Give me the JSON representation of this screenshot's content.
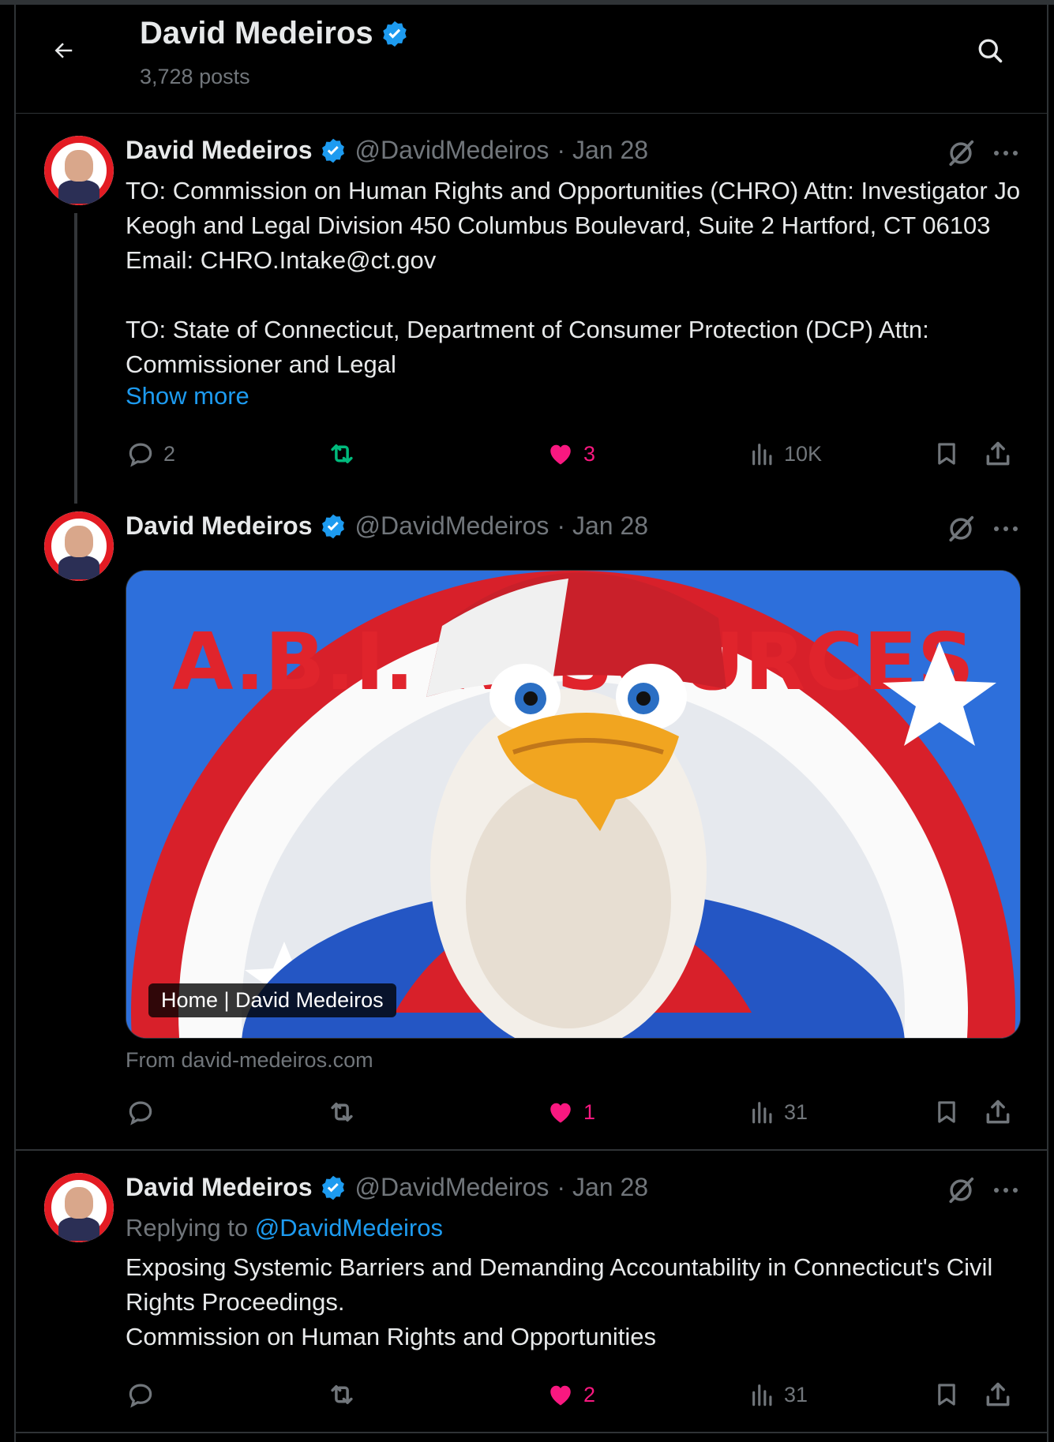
{
  "header": {
    "title": "David Medeiros",
    "posts_count": "3,728 posts"
  },
  "posts": [
    {
      "name": "David Medeiros",
      "handle": "@DavidMedeiros",
      "date": "· Jan 28",
      "text": "TO: Commission on Human Rights and Opportunities (CHRO) Attn: Investigator Jo Keogh and Legal Division 450 Columbus Boulevard, Suite 2 Hartford, CT 06103 Email: CHRO.Intake@ct.gov\n\nTO: State of Connecticut, Department of Consumer Protection (DCP) Attn: Commissioner and Legal",
      "show_more": "Show more",
      "replies": "2",
      "reposts": "",
      "likes": "3",
      "views": "10K"
    },
    {
      "name": "David Medeiros",
      "handle": "@DavidMedeiros",
      "date": "· Jan 28",
      "card_label": "Home | David Medeiros",
      "card_source": "From david-medeiros.com",
      "card_image_text": "A.B.I. RESOURCES",
      "replies": "",
      "reposts": "",
      "likes": "1",
      "views": "31"
    },
    {
      "name": "David Medeiros",
      "handle": "@DavidMedeiros",
      "date": "· Jan 28",
      "replying_prefix": "Replying to",
      "replying_handle": "@DavidMedeiros",
      "text": "Exposing Systemic Barriers and Demanding Accountability in Connecticut's Civil Rights Proceedings.\nCommission on Human Rights and Opportunities",
      "replies": "",
      "reposts": "",
      "likes": "2",
      "views": "31"
    }
  ],
  "avatar_badge_text": "A.B.I. RESOURCES",
  "colors": {
    "background": "#000000",
    "text": "#e7e9ea",
    "muted": "#71767b",
    "accent": "#1d9bf0",
    "like": "#f91880",
    "repost": "#00ba7c",
    "border": "#2f3336"
  },
  "icons": [
    "back-arrow-icon",
    "search-icon",
    "verified-badge-icon",
    "grok-icon",
    "more-icon",
    "reply-icon",
    "repost-icon",
    "like-icon",
    "views-icon",
    "bookmark-icon",
    "share-icon"
  ]
}
